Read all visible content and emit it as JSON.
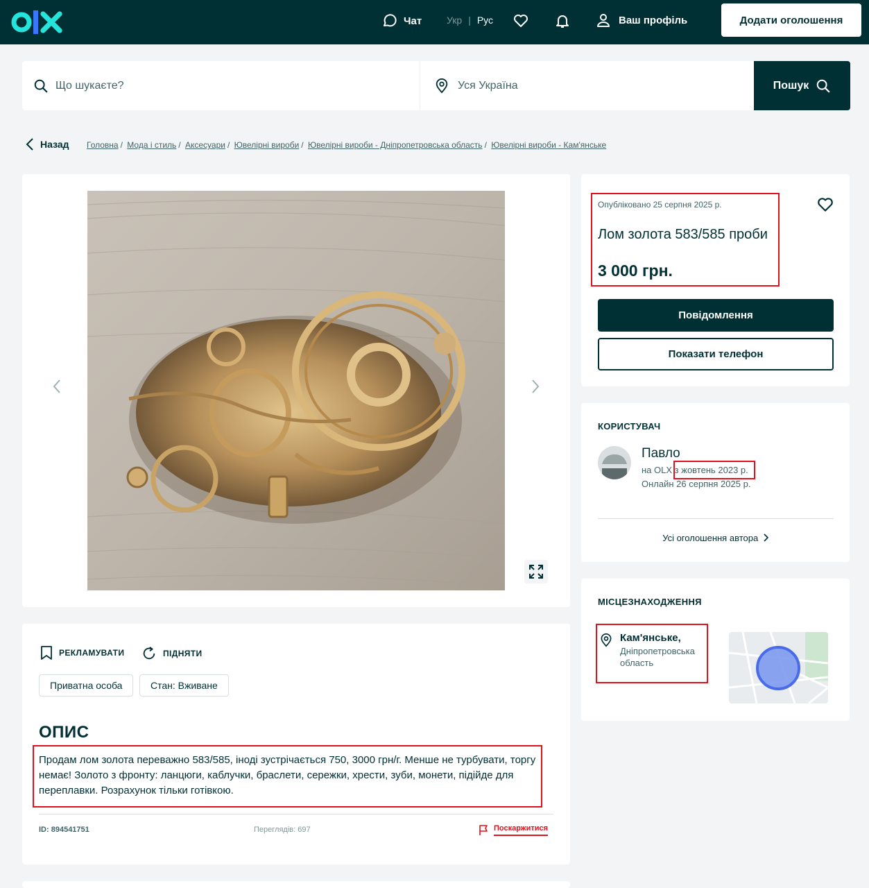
{
  "header": {
    "chat_label": "Чат",
    "lang_ukr": "Укр",
    "lang_sep": "|",
    "lang_rus": "Рус",
    "profile_label": "Ваш профіль",
    "add_ad_label": "Додати оголошення"
  },
  "search": {
    "query_placeholder": "Що шукаєте?",
    "location_placeholder": "Уся Україна",
    "button_label": "Пошук"
  },
  "breadcrumb": {
    "back_label": "Назад",
    "items": [
      "Головна",
      "Мода і стиль",
      "Аксесуари",
      "Ювелірні вироби",
      "Ювелірні вироби - Дніпропетровська область",
      "Ювелірні вироби - Кам'янське"
    ],
    "separator": "/"
  },
  "ad": {
    "published": "Опубліковано 25 серпня 2025 р.",
    "title": "Лом золота 583/585 проби",
    "price": "3 000 грн.",
    "message_button": "Повідомлення",
    "phone_button": "Показати телефон"
  },
  "user": {
    "section_title": "Користувач",
    "name": "Павло",
    "since_prefix": "на OLX",
    "since_date": "з жовтень 2023 р.",
    "online": "Онлайн 26 серпня 2025 р.",
    "all_ads_link": "Усі оголошення автора"
  },
  "location": {
    "section_title": "Місцезнаходження",
    "city": "Кам'янське,",
    "region": "Дніпропетровська область"
  },
  "details": {
    "promote_label": "РЕКЛАМУВАТИ",
    "raise_label": "ПІДНЯТИ",
    "tags": [
      "Приватна особа",
      "Стан: Вживане"
    ],
    "description_title": "ОПИС",
    "description": "Продам лом золота переважно 583/585, іноді зустрічається 750, 3000 грн/г. Менше не турбувати, торгу немає! Золото з фронту: ланцюги, каблучки, браслети, сережки, хрести, зуби, монети, підійде для переплавки. Розрахунок тільки готівкою.",
    "ad_id": "ID: 894541751",
    "views": "Переглядів: 697",
    "report_label": "Поскаржитися"
  },
  "colors": {
    "brand_dark": "#002f34",
    "brand_teal": "#23e5db",
    "highlight_red": "#e0101c",
    "page_bg": "#f2f4f5"
  },
  "icons": [
    "olx-logo",
    "chat-icon",
    "heart-icon",
    "bell-icon",
    "user-icon",
    "search-icon",
    "pin-icon",
    "chevron-left-icon",
    "chevron-right-icon",
    "expand-icon",
    "bookmark-icon",
    "refresh-icon",
    "flag-icon"
  ]
}
